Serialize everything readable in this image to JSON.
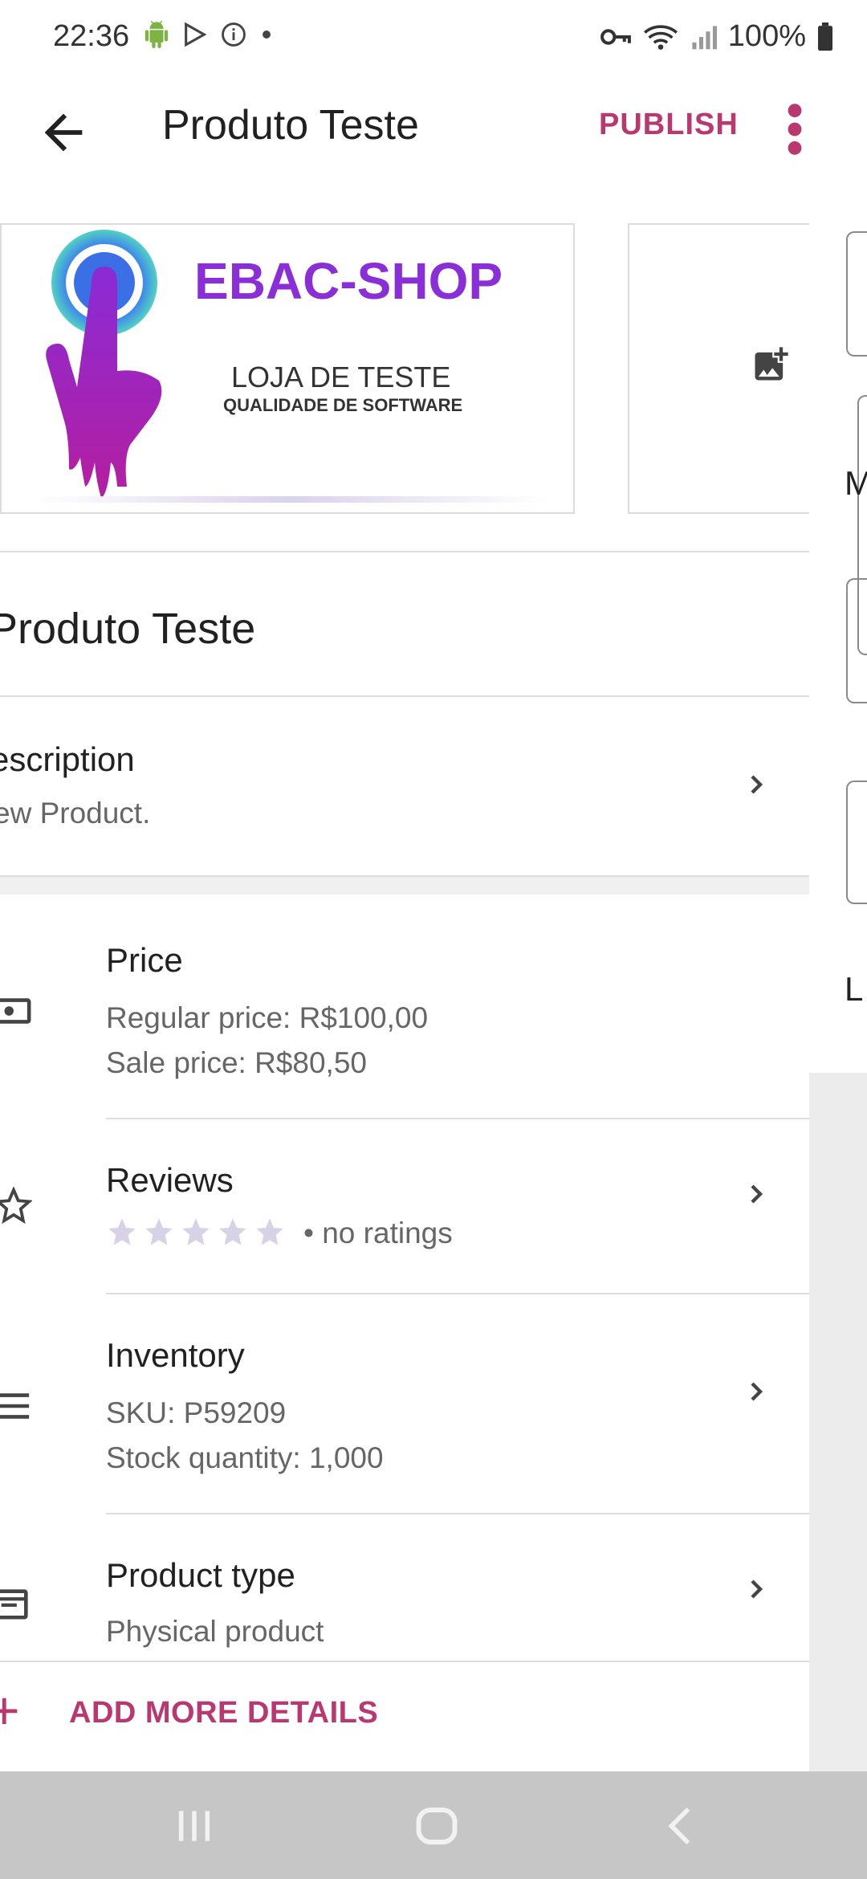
{
  "status_bar": {
    "time": "22:36",
    "battery": "100%"
  },
  "app_bar": {
    "title": "Produto Teste",
    "publish_label": "PUBLISH"
  },
  "product_image": {
    "brand": "EBAC-SHOP",
    "line1": "LOJA DE TESTE",
    "line2": "QUALIDADE DE SOFTWARE"
  },
  "product": {
    "name": "Produto Teste",
    "description_title": "escription",
    "description_value": "ew Product."
  },
  "rows": [
    {
      "title": "Price",
      "lines": [
        "Regular price: R$100,00",
        "Sale price: R$80,50"
      ]
    },
    {
      "title": "Reviews",
      "rating_text": "• no ratings",
      "stars": 0
    },
    {
      "title": "Inventory",
      "lines": [
        "SKU: P59209",
        "Stock quantity: 1,000"
      ]
    },
    {
      "title": "Product type",
      "lines": [
        "Physical product"
      ]
    }
  ],
  "add_more_label": "ADD MORE DETAILS",
  "right_panel": {
    "frag1": "M",
    "frag2": "L"
  },
  "colors": {
    "accent": "#b9386f",
    "nav_bar": "#c6c6c6"
  }
}
